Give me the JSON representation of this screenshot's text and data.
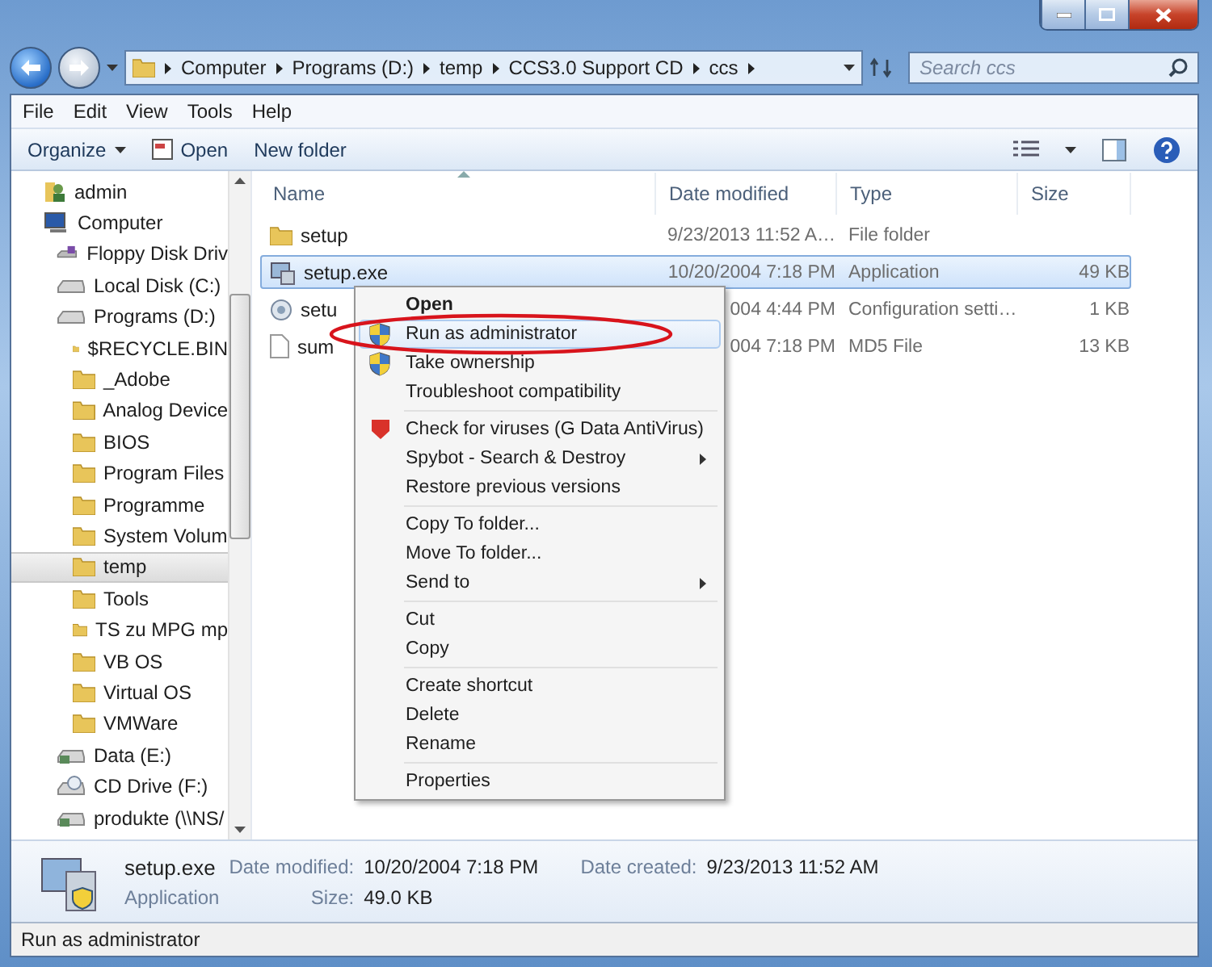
{
  "address": {
    "crumbs": [
      "Computer",
      "Programs (D:)",
      "temp",
      "CCS3.0 Support CD",
      "ccs"
    ]
  },
  "search": {
    "placeholder": "Search ccs"
  },
  "menu_bar": [
    "File",
    "Edit",
    "View",
    "Tools",
    "Help"
  ],
  "toolbar": {
    "organize": "Organize",
    "open": "Open",
    "new_folder": "New folder"
  },
  "navigation": [
    {
      "label": "admin",
      "kind": "user",
      "selected": false
    },
    {
      "label": "Computer",
      "kind": "computer",
      "selected": false,
      "children": [
        {
          "label": "Floppy Disk Driv",
          "kind": "floppy",
          "selected": false
        },
        {
          "label": "Local Disk (C:)",
          "kind": "disk",
          "selected": false
        },
        {
          "label": "Programs (D:)",
          "kind": "disk",
          "selected": false,
          "children": [
            {
              "label": "$RECYCLE.BIN",
              "kind": "folder",
              "selected": false
            },
            {
              "label": "_Adobe",
              "kind": "folder",
              "selected": false
            },
            {
              "label": "Analog Device",
              "kind": "folder",
              "selected": false
            },
            {
              "label": "BIOS",
              "kind": "folder",
              "selected": false
            },
            {
              "label": "Program Files",
              "kind": "folder",
              "selected": false
            },
            {
              "label": "Programme",
              "kind": "folder",
              "selected": false
            },
            {
              "label": "System Volum",
              "kind": "folder",
              "selected": false
            },
            {
              "label": "temp",
              "kind": "folder",
              "selected": true
            },
            {
              "label": "Tools",
              "kind": "folder",
              "selected": false
            },
            {
              "label": "TS zu MPG mp",
              "kind": "folder",
              "selected": false
            },
            {
              "label": "VB OS",
              "kind": "folder",
              "selected": false
            },
            {
              "label": "Virtual OS",
              "kind": "folder",
              "selected": false
            },
            {
              "label": "VMWare",
              "kind": "folder",
              "selected": false
            }
          ]
        },
        {
          "label": "Data (E:)",
          "kind": "network",
          "selected": false
        },
        {
          "label": "CD Drive (F:)",
          "kind": "cd",
          "selected": false
        },
        {
          "label": "produkte (\\\\NS/",
          "kind": "network",
          "selected": false
        }
      ]
    }
  ],
  "file_list": {
    "columns": [
      "Name",
      "Date modified",
      "Type",
      "Size"
    ],
    "rows": [
      {
        "name": "setup",
        "date": "9/23/2013 11:52 A…",
        "type": "File folder",
        "kind": "folder",
        "selected": false
      },
      {
        "name": "setup.exe",
        "date": "10/20/2004 7:18 PM",
        "type": "Application",
        "size": "49 KB",
        "kind": "app",
        "selected": true
      },
      {
        "name": "setu",
        "date": "004 4:44 PM",
        "type": "Configuration setti…",
        "size": "1 KB",
        "kind": "config",
        "selected": false
      },
      {
        "name": "sum",
        "date": "004 7:18 PM",
        "type": "MD5 File",
        "size": "13 KB",
        "kind": "file",
        "selected": false
      }
    ]
  },
  "context_menu": {
    "groups": [
      {
        "items": [
          {
            "label": "Open",
            "kind": "default",
            "selected": false
          },
          {
            "label": "Run as administrator",
            "kind": "shield",
            "selected": true
          },
          {
            "label": "Take ownership",
            "kind": "shield",
            "selected": false
          },
          {
            "label": "Troubleshoot compatibility",
            "kind": "plain",
            "selected": false
          }
        ]
      },
      {
        "items": [
          {
            "label": "Check for viruses (G Data AntiVirus)",
            "kind": "antivirus",
            "selected": false
          },
          {
            "label": "Spybot - Search & Destroy",
            "kind": "submenu",
            "selected": false
          },
          {
            "label": "Restore previous versions",
            "kind": "plain",
            "selected": false
          }
        ]
      },
      {
        "items": [
          {
            "label": "Copy To folder...",
            "kind": "plain",
            "selected": false
          },
          {
            "label": "Move To folder...",
            "kind": "plain",
            "selected": false
          },
          {
            "label": "Send to",
            "kind": "submenu",
            "selected": false
          }
        ]
      },
      {
        "items": [
          {
            "label": "Cut",
            "kind": "plain",
            "selected": false
          },
          {
            "label": "Copy",
            "kind": "plain",
            "selected": false
          }
        ]
      },
      {
        "items": [
          {
            "label": "Create shortcut",
            "kind": "plain",
            "selected": false
          },
          {
            "label": "Delete",
            "kind": "plain",
            "selected": false
          },
          {
            "label": "Rename",
            "kind": "plain",
            "selected": false
          }
        ]
      },
      {
        "items": [
          {
            "label": "Properties",
            "kind": "plain",
            "selected": false
          }
        ]
      }
    ]
  },
  "details": {
    "name": "setup.exe",
    "type": "Application",
    "fields": [
      {
        "label": "Date modified:",
        "value": "10/20/2004 7:18 PM"
      },
      {
        "label": "Date created:",
        "value": "9/23/2013 11:52 AM"
      },
      {
        "label": "Size:",
        "value": "49.0 KB"
      }
    ]
  },
  "status_bar": "Run as administrator"
}
